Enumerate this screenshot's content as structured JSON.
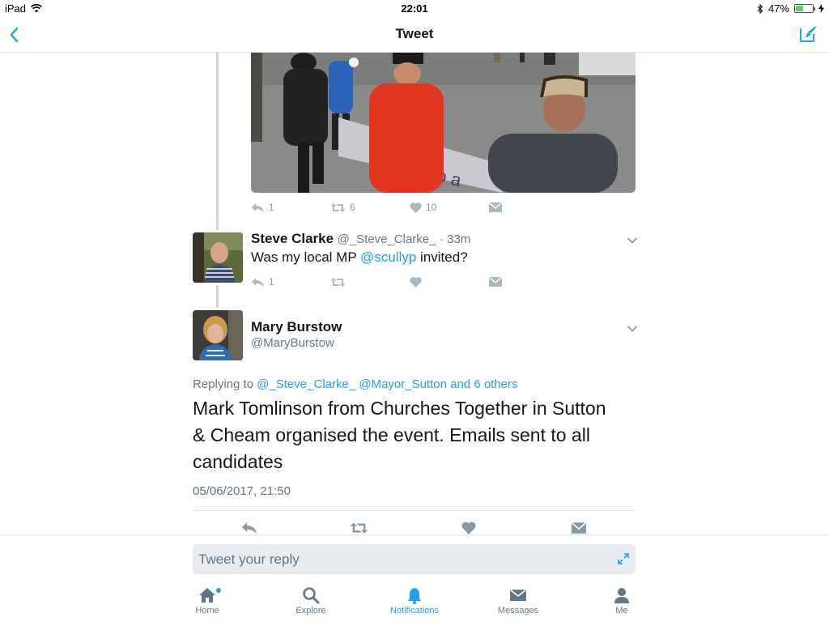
{
  "status_bar": {
    "device": "iPad",
    "time": "22:01",
    "battery": "47%",
    "battery_level": 0.47
  },
  "nav": {
    "title": "Tweet"
  },
  "previous_tweet": {
    "reply_count": "1",
    "retweet_count": "6",
    "like_count": "10"
  },
  "reply_tweet": {
    "author_name": "Steve Clarke",
    "author_handle": "@_Steve_Clarke_",
    "time_ago": "· 33m",
    "text_before": "Was my local MP ",
    "mention": "@scullyp",
    "text_after": " invited?",
    "reply_count": "1"
  },
  "main_tweet": {
    "author_name": "Mary Burstow",
    "author_handle": "@MaryBurstow",
    "replying_prefix": "Replying to ",
    "replying_to": "@_Steve_Clarke_ @Mayor_Sutton and 6 others",
    "body": "Mark Tomlinson from Churches Together in Sutton & Cheam organised the event.  Emails sent to all candidates",
    "timestamp": "05/06/2017, 21:50"
  },
  "reply_box": {
    "placeholder": "Tweet your reply"
  },
  "tabs": [
    {
      "label": "Home",
      "icon": "home-icon",
      "has_dot": true
    },
    {
      "label": "Explore",
      "icon": "search-icon"
    },
    {
      "label": "Notifications",
      "icon": "bell-icon",
      "active": true
    },
    {
      "label": "Messages",
      "icon": "envelope-icon"
    },
    {
      "label": "Me",
      "icon": "person-icon"
    }
  ],
  "colors": {
    "accent": "#1da1f2",
    "text_primary": "#14171a",
    "text_secondary": "#657786",
    "icon_gray": "#8899a6",
    "thread_line": "#ccd6dd"
  }
}
